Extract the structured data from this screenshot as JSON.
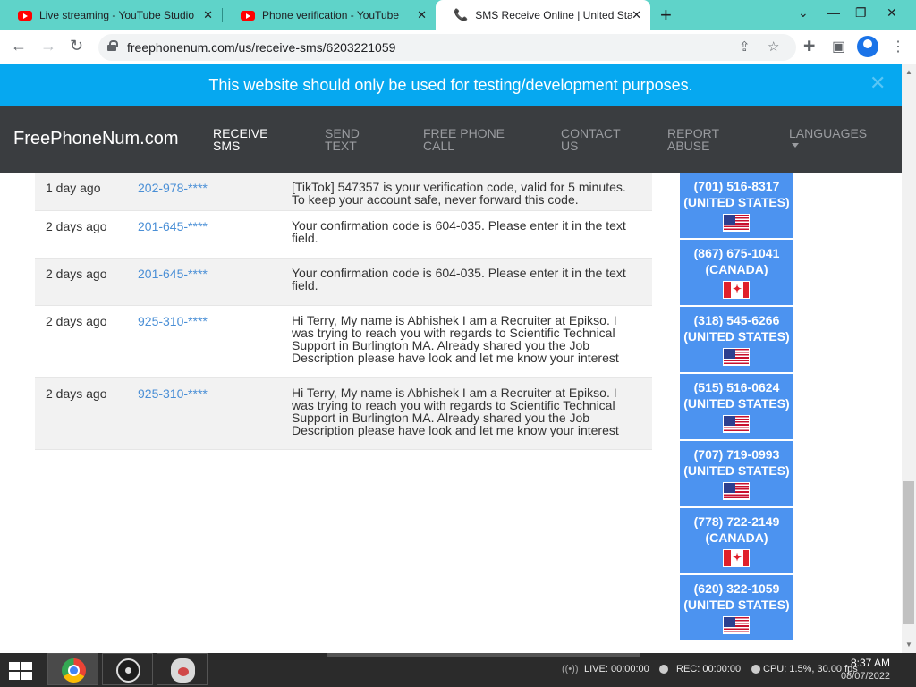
{
  "browser": {
    "tabs": [
      {
        "title": "Live streaming - YouTube Studio",
        "icon": "youtube-icon"
      },
      {
        "title": "Phone verification - YouTube",
        "icon": "youtube-icon"
      },
      {
        "title": "SMS Receive Online | United Stat",
        "icon": "phone-icon",
        "active": true
      }
    ],
    "url": "freephonenum.com/us/receive-sms/6203221059"
  },
  "banner": {
    "text": "This website should only be used for testing/development purposes."
  },
  "site": {
    "brand": "FreePhoneNum.com",
    "nav": [
      {
        "l1": "RECEIVE",
        "l2": "SMS",
        "active": true
      },
      {
        "l1": "SEND",
        "l2": "TEXT"
      },
      {
        "l1": "FREE PHONE",
        "l2": "CALL"
      },
      {
        "l1": "CONTACT",
        "l2": "US"
      },
      {
        "l1": "REPORT",
        "l2": "ABUSE"
      },
      {
        "l1": "LANGUAGES",
        "l2": ""
      }
    ]
  },
  "messages": [
    {
      "time": "1 day ago",
      "from": "202-978-****",
      "text": "[TikTok] 547357 is your verification code, valid for 5 minutes. To keep your account safe, never forward this code."
    },
    {
      "time": "2 days ago",
      "from": "201-645-****",
      "text": "Your confirmation code is 604-035. Please enter it in the text field."
    },
    {
      "time": "2 days ago",
      "from": "201-645-****",
      "text": "Your confirmation code is 604-035. Please enter it in the text field."
    },
    {
      "time": "2 days ago",
      "from": "925-310-****",
      "text": "Hi Terry, My name is Abhishek I am a Recruiter at Epikso. I was trying to reach you with regards to Scientific Technical Support in Burlington MA. Already shared you the Job Description please have look and let me know your interest"
    },
    {
      "time": "2 days ago",
      "from": "925-310-****",
      "text": "Hi Terry, My name is Abhishek I am a Recruiter at Epikso. I was trying to reach you with regards to Scientific Technical Support in Burlington MA. Already shared you the Job Description please have look and let me know your interest"
    }
  ],
  "numbers": [
    {
      "number": "(701) 516-8317",
      "country": "(UNITED STATES)",
      "flag": "us"
    },
    {
      "number": "(867) 675-1041",
      "country": "(CANADA)",
      "flag": "ca"
    },
    {
      "number": "(318) 545-6266",
      "country": "(UNITED STATES)",
      "flag": "us"
    },
    {
      "number": "(515) 516-0624",
      "country": "(UNITED STATES)",
      "flag": "us"
    },
    {
      "number": "(707) 719-0993",
      "country": "(UNITED STATES)",
      "flag": "us"
    },
    {
      "number": "(778) 722-2149",
      "country": "(CANADA)",
      "flag": "ca"
    },
    {
      "number": "(620) 322-1059",
      "country": "(UNITED STATES)",
      "flag": "us"
    }
  ],
  "taskbar": {
    "live": "LIVE: 00:00:00",
    "rec": "REC: 00:00:00",
    "cpu": "CPU: 1.5%, 30.00 fps",
    "time": "8:37 AM",
    "date": "08/07/2022"
  }
}
